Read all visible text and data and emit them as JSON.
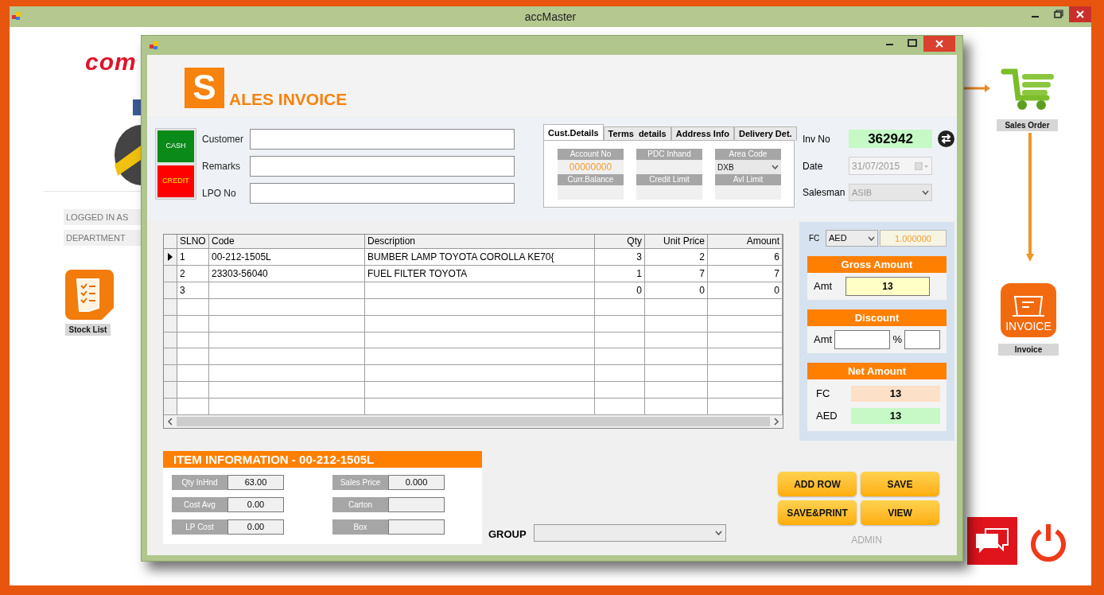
{
  "app_window": {
    "title": "accMaster"
  },
  "desktop": {
    "logo_text": "com",
    "info_labels": [
      "LOGGED IN AS",
      "DEPARTMENT"
    ],
    "shortcuts": [
      {
        "label": "Stock List",
        "kind": "stock"
      },
      {
        "label": "Sales Order",
        "kind": "cart"
      },
      {
        "label": "Invoice",
        "kind": "invoice",
        "icon_text": "INVOICE"
      }
    ]
  },
  "invoice_window": {
    "logo_letter": "S",
    "title": "ALES INVOICE",
    "payment_buttons": [
      {
        "label": "CASH",
        "kind": "cash"
      },
      {
        "label": "CREDIT",
        "kind": "credit"
      }
    ],
    "fields": [
      {
        "label": "Customer"
      },
      {
        "label": "Remarks"
      },
      {
        "label": "LPO No"
      }
    ],
    "tabs": [
      {
        "label": "Cust.Details",
        "selected": true
      },
      {
        "label": "Terms  details",
        "selected": false
      },
      {
        "label": "Address Info",
        "selected": false
      },
      {
        "label": "Delivery Det.",
        "selected": false
      }
    ],
    "cust_details": [
      {
        "label": "Account No",
        "kind": "text",
        "value": "00000000"
      },
      {
        "label": "PDC Inhand",
        "kind": "text"
      },
      {
        "label": "Area Code",
        "kind": "select",
        "value": "DXB"
      },
      {
        "label": "Curr.Balance",
        "kind": "text"
      },
      {
        "label": "Credit Limit",
        "kind": "text"
      },
      {
        "label": "Avl Limit",
        "kind": "text"
      }
    ],
    "inv_no": {
      "label": "Inv No",
      "value": "362942"
    },
    "date": {
      "label": "Date",
      "value": "31/07/2015"
    },
    "salesman": {
      "label": "Salesman",
      "value": "ASIB"
    },
    "grid": {
      "columns": [
        "SLNO",
        "Code",
        "Description",
        "Qty",
        "Unit Price",
        "Amount"
      ],
      "rows": [
        {
          "slno": "1",
          "code": "00-212-1505L",
          "description": "BUMBER LAMP TOYOTA COROLLA KE70{",
          "qty": "3",
          "unit_price": "2",
          "amount": "6",
          "current": true
        },
        {
          "slno": "2",
          "code": "23303-56040",
          "description": "FUEL FILTER TOYOTA",
          "qty": "1",
          "unit_price": "7",
          "amount": "7",
          "current": false
        },
        {
          "slno": "3",
          "qty": "0",
          "unit_price": "0",
          "amount": "0",
          "current": false
        }
      ]
    },
    "currency": {
      "label": "FC",
      "value": "AED",
      "rate": "1.000000"
    },
    "gross": {
      "title": "Gross Amount",
      "label": "Amt",
      "value": "13"
    },
    "discount": {
      "title": "Discount",
      "label": "Amt",
      "percent_label": "%"
    },
    "net": {
      "title": "Net Amount",
      "rows": [
        {
          "label": "FC",
          "value": "13",
          "color": "#fde0c8"
        },
        {
          "label": "AED",
          "value": "13",
          "color": "#c6f9c6"
        }
      ]
    },
    "item_info": {
      "title": "ITEM INFORMATION - 00-212-1505L",
      "fields": [
        {
          "label": "Qty InHnd",
          "value": "63.00"
        },
        {
          "label": "Cost Avg",
          "value": "0.00"
        },
        {
          "label": "LP Cost",
          "value": "0.00"
        },
        {
          "label": "Sales Price",
          "value": "0.000"
        },
        {
          "label": "Carton"
        },
        {
          "label": "Box"
        }
      ]
    },
    "group": {
      "label": "GROUP"
    },
    "buttons": [
      "ADD ROW",
      "SAVE",
      "SAVE&PRINT",
      "VIEW"
    ],
    "user": "ADMIN"
  }
}
